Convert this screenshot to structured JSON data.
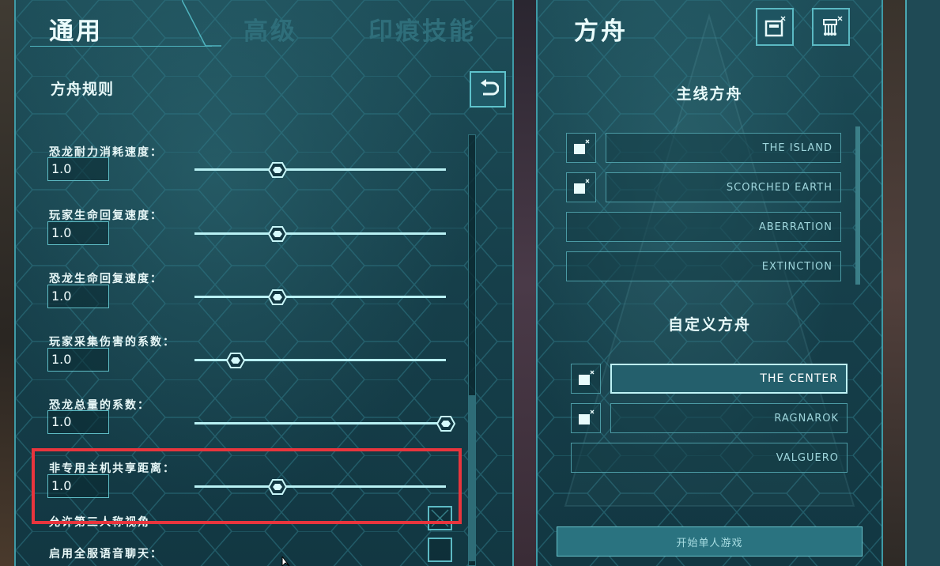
{
  "tabs": {
    "general": "通用",
    "advanced": "高级",
    "engram": "印痕技能"
  },
  "left_panel": {
    "section_title": "方舟规则",
    "settings": [
      {
        "label": "恐龙耐力消耗速度：",
        "value": "1.0",
        "level": 0.33
      },
      {
        "label": "玩家生命回复速度：",
        "value": "1.0",
        "level": 0.33
      },
      {
        "label": "恐龙生命回复速度：",
        "value": "1.0",
        "level": 0.33
      },
      {
        "label": "玩家采集伤害的系数：",
        "value": "1.0",
        "level": 0.165
      },
      {
        "label": "恐龙总量的系数：",
        "value": "1.0",
        "level": 1.0
      },
      {
        "label": "非专用主机共享距离：",
        "value": "1.0",
        "level": 0.33
      }
    ],
    "checkbox_settings": [
      {
        "label": "允许第三人称视角",
        "checked": true
      },
      {
        "label": "启用全服语音聊天：",
        "checked": false
      }
    ]
  },
  "right_panel": {
    "title": "方舟",
    "main_group_title": "主线方舟",
    "main_maps": [
      "THE   ISLAND",
      "SCORCHED   EARTH",
      "ABERRATION",
      "EXTINCTION"
    ],
    "custom_group_title": "自定义方舟",
    "custom_maps": [
      "THE   CENTER",
      "RAGNAROK",
      "VALGUERO"
    ],
    "selected_map": "THE   CENTER",
    "start_button": "开始单人游戏"
  },
  "colors": {
    "panel_bg": "#1d4d58",
    "accent": "#5ec3cc",
    "highlight_box": "#e8353d",
    "slider_track": "#b9f1f4"
  }
}
